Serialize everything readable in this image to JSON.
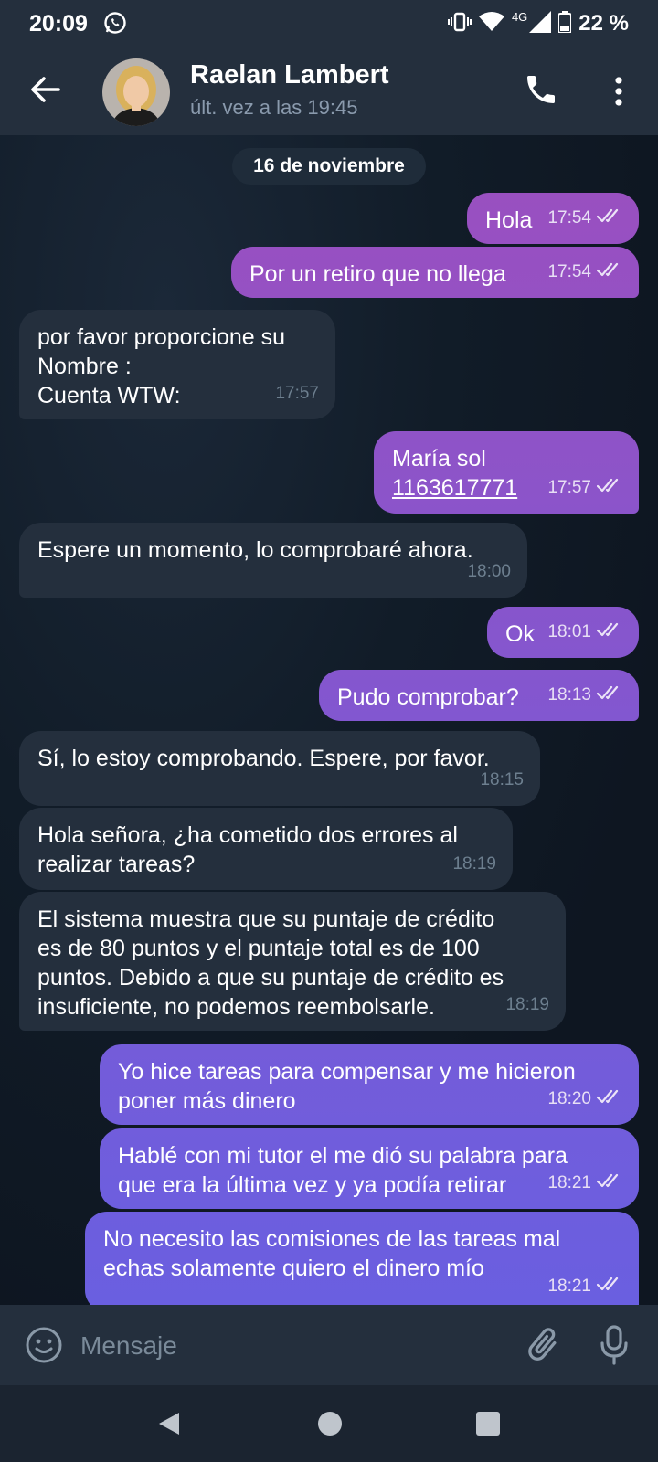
{
  "status_bar": {
    "time": "20:09",
    "network": "4G",
    "battery": "22 %"
  },
  "header": {
    "name": "Raelan Lambert",
    "last_seen": "últ. vez a las 19:45"
  },
  "date_separator": "16 de noviembre",
  "messages": [
    {
      "dir": "out",
      "text": "Hola",
      "time": "17:54"
    },
    {
      "dir": "out",
      "text": "Por un retiro que no llega",
      "time": "17:54"
    },
    {
      "dir": "in",
      "text": "por favor proporcione su\nNombre :\nCuenta WTW:",
      "time": "17:57"
    },
    {
      "dir": "out",
      "text": "María sol",
      "link": "1163617771",
      "time": "17:57"
    },
    {
      "dir": "in",
      "text": "Espere un momento, lo comprobaré ahora.",
      "time": "18:00"
    },
    {
      "dir": "out",
      "text": "Ok",
      "time": "18:01"
    },
    {
      "dir": "out",
      "text": "Pudo comprobar?",
      "time": "18:13"
    },
    {
      "dir": "in",
      "text": "Sí, lo estoy comprobando. Espere, por favor.",
      "time": "18:15"
    },
    {
      "dir": "in",
      "text": "Hola señora, ¿ha cometido dos errores al\nrealizar tareas?",
      "time": "18:19"
    },
    {
      "dir": "in",
      "text": "El sistema muestra que su puntaje de crédito\nes de 80 puntos y el puntaje total es de 100\npuntos. Debido a que su puntaje de crédito es\ninsuficiente, no podemos reembolsarle.",
      "time": "18:19"
    },
    {
      "dir": "out",
      "text": "Yo hice tareas para compensar y me hicieron\nponer más dinero",
      "time": "18:20"
    },
    {
      "dir": "out",
      "text": "Hablé con mi tutor el me dió su palabra para\nque era la última vez y ya podía retirar",
      "time": "18:21"
    },
    {
      "dir": "out",
      "text": "No necesito las comisiones de las tareas mal\nechas solamente quiero el dinero mío",
      "time": "18:21"
    }
  ],
  "input": {
    "placeholder": "Mensaje"
  },
  "colors": {
    "outgoing_top": "#9b4fbf",
    "outgoing_bottom": "#6a5fe0",
    "incoming": "#242f3d",
    "background": "#0e1621"
  },
  "icons": [
    "whatsapp-icon",
    "vibrate-icon",
    "wifi-icon",
    "signal-icon",
    "battery-icon",
    "back-arrow-icon",
    "phone-icon",
    "more-vert-icon",
    "double-check-icon",
    "emoji-icon",
    "attach-icon",
    "mic-icon",
    "nav-back-icon",
    "nav-home-icon",
    "nav-recents-icon"
  ]
}
